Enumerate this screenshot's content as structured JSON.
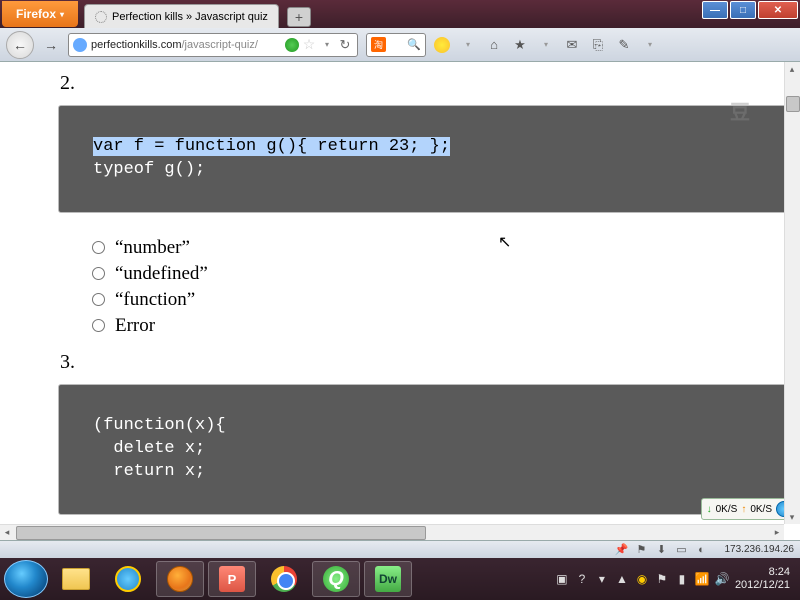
{
  "window": {
    "firefox_label": "Firefox",
    "tab_title": "Perfection kills » Javascript quiz",
    "new_tab": "+",
    "min": "—",
    "max": "□",
    "close": "✕"
  },
  "toolbar": {
    "back": "←",
    "forward": "→",
    "url_prefix": "perfectionkills.com",
    "url_path": "/javascript-quiz/",
    "star": "☆",
    "dropdown": "▾",
    "reload": "↻",
    "taobao": "淘",
    "search_tag": "淘",
    "search_mag": "🔍",
    "home": "⌂",
    "bookmark": "★",
    "mail": "✉",
    "down": "▾"
  },
  "page": {
    "cut_text": "",
    "q2_num": "2.",
    "q2_code_hl": "var f = function g(){ return 23; };",
    "q2_code_rest": "typeof g();",
    "q2_options": [
      "“number”",
      "“undefined”",
      "“function”",
      "Error"
    ],
    "q3_num": "3.",
    "q3_code": "(function(x){\n  delete x;\n  return x;"
  },
  "netmon": {
    "down_arrow": "↓",
    "down_rate": "0K/S",
    "up_arrow": "↑",
    "up_rate": "0K/S"
  },
  "statusbar": {
    "ip": "173.236.194.26"
  },
  "taskbar": {
    "ppt": "P",
    "iq": "Q",
    "dw": "Dw",
    "time": "8:24",
    "date": "2012/12/21",
    "tray_expand": "▲"
  }
}
